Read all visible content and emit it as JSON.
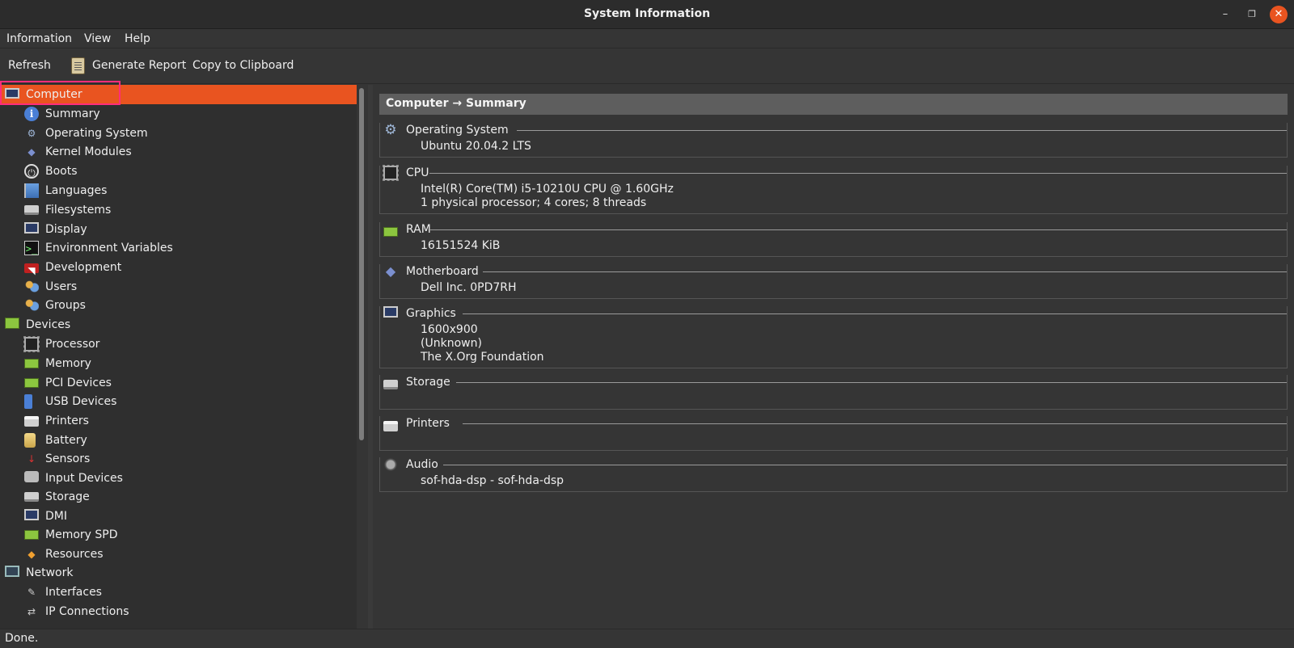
{
  "window": {
    "title": "System Information"
  },
  "menu": [
    "Information",
    "View",
    "Help"
  ],
  "toolbar": {
    "refresh": "Refresh",
    "report": "Generate Report",
    "copy": "Copy to Clipboard"
  },
  "tree": [
    {
      "label": "Computer",
      "icon": "computer-icon",
      "level": 0,
      "selected": true
    },
    {
      "label": "Summary",
      "icon": "info-icon",
      "level": 1
    },
    {
      "label": "Operating System",
      "icon": "gear-icon",
      "level": 1
    },
    {
      "label": "Kernel Modules",
      "icon": "module-icon",
      "level": 1
    },
    {
      "label": "Boots",
      "icon": "power-icon",
      "level": 1
    },
    {
      "label": "Languages",
      "icon": "flag-icon",
      "level": 1
    },
    {
      "label": "Filesystems",
      "icon": "disk-icon",
      "level": 1
    },
    {
      "label": "Display",
      "icon": "monitor-icon",
      "level": 1
    },
    {
      "label": "Environment Variables",
      "icon": "terminal-icon",
      "level": 1
    },
    {
      "label": "Development",
      "icon": "development-icon",
      "level": 1
    },
    {
      "label": "Users",
      "icon": "users-icon",
      "level": 1
    },
    {
      "label": "Groups",
      "icon": "groups-icon",
      "level": 1
    },
    {
      "label": "Devices",
      "icon": "devices-icon",
      "level": 0
    },
    {
      "label": "Processor",
      "icon": "processor-icon",
      "level": 1
    },
    {
      "label": "Memory",
      "icon": "memory-icon",
      "level": 1
    },
    {
      "label": "PCI Devices",
      "icon": "pci-icon",
      "level": 1
    },
    {
      "label": "USB Devices",
      "icon": "usb-icon",
      "level": 1
    },
    {
      "label": "Printers",
      "icon": "printer-icon",
      "level": 1
    },
    {
      "label": "Battery",
      "icon": "battery-icon",
      "level": 1
    },
    {
      "label": "Sensors",
      "icon": "sensor-icon",
      "level": 1
    },
    {
      "label": "Input Devices",
      "icon": "input-device-icon",
      "level": 1
    },
    {
      "label": "Storage",
      "icon": "storage-icon",
      "level": 1
    },
    {
      "label": "DMI",
      "icon": "dmi-icon",
      "level": 1
    },
    {
      "label": "Memory SPD",
      "icon": "memory-spd-icon",
      "level": 1
    },
    {
      "label": "Resources",
      "icon": "resources-icon",
      "level": 1
    },
    {
      "label": "Network",
      "icon": "network-icon",
      "level": 0
    },
    {
      "label": "Interfaces",
      "icon": "interfaces-icon",
      "level": 1
    },
    {
      "label": "IP Connections",
      "icon": "ip-connections-icon",
      "level": 1
    }
  ],
  "content": {
    "breadcrumb": "Computer → Summary",
    "sections": [
      {
        "title": "Operating System",
        "icon": "gear-icon",
        "lines": [
          "Ubuntu 20.04.2 LTS"
        ]
      },
      {
        "title": "CPU",
        "icon": "processor-icon",
        "lines": [
          "Intel(R) Core(TM) i5-10210U CPU @ 1.60GHz",
          "1 physical processor; 4 cores; 8 threads"
        ]
      },
      {
        "title": "RAM",
        "icon": "memory-icon",
        "lines": [
          "16151524 KiB"
        ]
      },
      {
        "title": "Motherboard",
        "icon": "module-icon",
        "lines": [
          "Dell Inc. 0PD7RH"
        ]
      },
      {
        "title": "Graphics",
        "icon": "monitor-icon",
        "lines": [
          "1600x900",
          "(Unknown)",
          "The X.Org Foundation"
        ]
      },
      {
        "title": "Storage",
        "icon": "storage-icon",
        "lines": []
      },
      {
        "title": "Printers",
        "icon": "printer-icon",
        "lines": []
      },
      {
        "title": "Audio",
        "icon": "audio-icon",
        "lines": [
          "sof-hda-dsp - sof-hda-dsp"
        ]
      }
    ]
  },
  "status": "Done.",
  "colors": {
    "accent": "#e95420",
    "highlight": "#ff2d7a"
  }
}
